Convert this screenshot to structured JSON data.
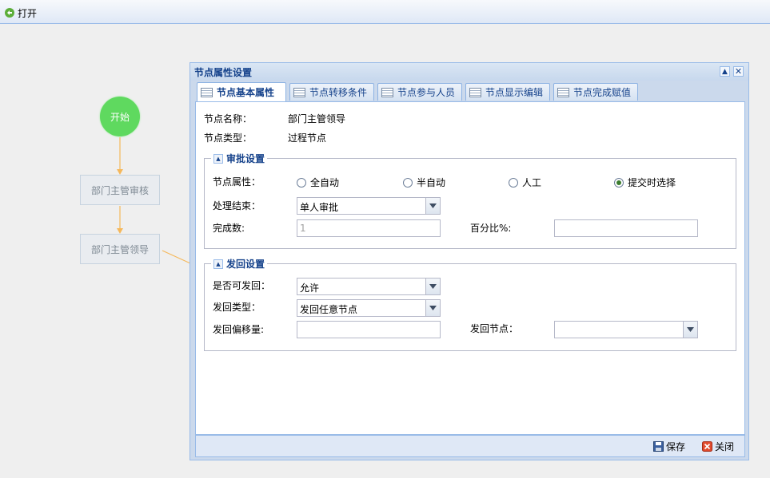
{
  "toolbar": {
    "open_label": "打开"
  },
  "flow": {
    "start_label": "开始",
    "node1_label": "部门主管审核",
    "node2_label": "部门主管领导",
    "line_color": "#f5b85b",
    "start_color": "#5fd95f"
  },
  "dialog": {
    "title": "节点属性设置",
    "tabs": [
      {
        "label": "节点基本属性",
        "active": true
      },
      {
        "label": "节点转移条件"
      },
      {
        "label": "节点参与人员"
      },
      {
        "label": "节点显示编辑"
      },
      {
        "label": "节点完成赋值"
      }
    ],
    "basic": {
      "name_label": "节点名称：",
      "name_value": "部门主管领导",
      "type_label": "节点类型：",
      "type_value": "过程节点"
    },
    "approval": {
      "legend": "审批设置",
      "prop_label": "节点属性：",
      "options": [
        "全自动",
        "半自动",
        "人工",
        "提交时选择"
      ],
      "selected": "提交时选择",
      "end_label": "处理结束：",
      "end_value": "单人审批",
      "count_label": "完成数:",
      "count_value": "1",
      "percent_label": "百分比%:",
      "percent_value": ""
    },
    "sendback": {
      "legend": "发回设置",
      "allow_label": "是否可发回：",
      "allow_value": "允许",
      "type_label": "发回类型：",
      "type_value": "发回任意节点",
      "offset_label": "发回偏移量:",
      "offset_value": "",
      "node_label": "发回节点：",
      "node_value": ""
    },
    "buttons": {
      "save": "保存",
      "close": "关闭"
    }
  }
}
